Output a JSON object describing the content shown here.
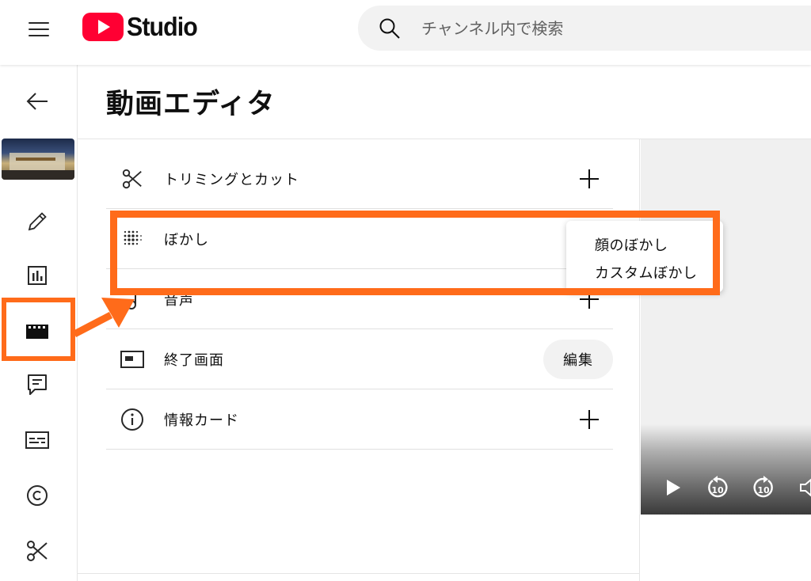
{
  "app": {
    "logo_text": "Studio"
  },
  "search": {
    "placeholder": "チャンネル内で検索"
  },
  "page": {
    "title": "動画エディタ"
  },
  "colors": {
    "brand_red": "#ff0033",
    "annotation_orange": "#ff6b1a"
  },
  "sidebar": {
    "items": [
      {
        "icon": "back-arrow-icon"
      },
      {
        "icon": "video-thumbnail"
      },
      {
        "icon": "pencil-icon"
      },
      {
        "icon": "analytics-icon"
      },
      {
        "icon": "editor-clapper-icon",
        "selected": true
      },
      {
        "icon": "comments-icon"
      },
      {
        "icon": "subtitles-icon"
      },
      {
        "icon": "copyright-icon"
      },
      {
        "icon": "scissors-icon"
      }
    ]
  },
  "tools": [
    {
      "label": "トリミングとカット",
      "icon": "scissors-icon",
      "action": "plus"
    },
    {
      "label": "ぼかし",
      "icon": "blur-dots-icon",
      "action": "menu"
    },
    {
      "label": "音声",
      "icon": "music-note-icon",
      "action": "plus"
    },
    {
      "label": "終了画面",
      "icon": "end-screen-icon",
      "action": "button",
      "action_label": "編集"
    },
    {
      "label": "情報カード",
      "icon": "info-icon",
      "action": "plus"
    }
  ],
  "blur_menu": {
    "items": [
      "顔のぼかし",
      "カスタムぼかし"
    ]
  },
  "player": {
    "controls": [
      "play-icon",
      "rewind-10-icon",
      "forward-10-icon",
      "volume-icon"
    ]
  }
}
